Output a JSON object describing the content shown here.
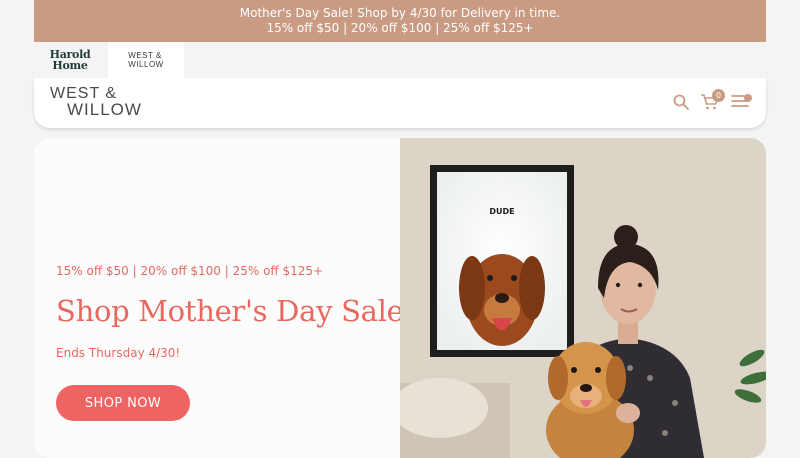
{
  "announcement": {
    "line1": "Mother's Day Sale! Shop by 4/30 for Delivery in time.",
    "line2": "15% off $50 | 20% off $100 | 25% off $125+"
  },
  "brands": [
    {
      "line1": "Harold",
      "line2": "Home"
    },
    {
      "line1": "WEST &",
      "line2": "WILLOW"
    }
  ],
  "header": {
    "logo_line1": "WEST &",
    "logo_line2": "WILLOW",
    "cart_count": "0",
    "icons": [
      "search-icon",
      "cart-icon",
      "menu-icon"
    ]
  },
  "hero": {
    "offer": "15% off $50 | 20% off $100 | 25% off $125+",
    "title": "Shop Mother's Day Sale",
    "subtitle": "Ends Thursday 4/30!",
    "cta": "SHOP NOW",
    "poster_text": "DUDE"
  },
  "colors": {
    "announcement_bg": "#c99b82",
    "accent": "#ef6463"
  }
}
